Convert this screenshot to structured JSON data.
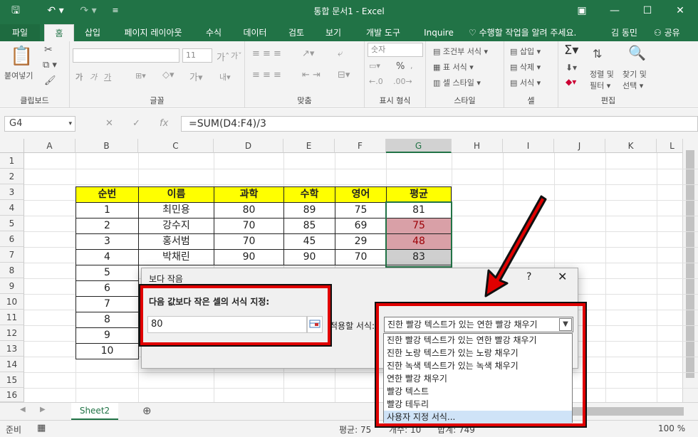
{
  "titlebar": {
    "title": "통합 문서1 - Excel",
    "save_icon": "save-icon",
    "undo_icon": "undo-icon",
    "redo_icon": "redo-icon"
  },
  "tabs": [
    "파일",
    "홈",
    "삽입",
    "페이지 레이아웃",
    "수식",
    "데이터",
    "검토",
    "보기",
    "개발 도구",
    "Inquire"
  ],
  "tellme": "수행할 작업을 알려 주세요.",
  "user": "김 동민",
  "share": "공유",
  "ribbon": {
    "clipboard": {
      "label": "클립보드",
      "paste": "붙여넣기"
    },
    "font": {
      "label": "글꼴",
      "size": "11",
      "bold": "가",
      "italic": "가",
      "underline": "가"
    },
    "alignment": {
      "label": "맞춤"
    },
    "number": {
      "label": "표시 형식",
      "format": "숫자",
      "percent": "%"
    },
    "styles": {
      "label": "스타일",
      "conditional": "조건부 서식",
      "table": "표 서식",
      "cell": "셀 스타일"
    },
    "cells": {
      "label": "셀",
      "insert": "삽입",
      "delete": "삭제",
      "format": "서식"
    },
    "editing": {
      "label": "편집",
      "sort": "정렬 및",
      "filter": "필터",
      "find": "찾기 및",
      "select": "선택"
    }
  },
  "formula_bar": {
    "namebox": "G4",
    "formula": "=SUM(D4:F4)/3",
    "fx": "fx"
  },
  "columns": [
    "A",
    "B",
    "C",
    "D",
    "E",
    "F",
    "G",
    "H",
    "I",
    "J",
    "K",
    "L"
  ],
  "rows": [
    "1",
    "2",
    "3",
    "4",
    "5",
    "6",
    "7",
    "8",
    "9",
    "10",
    "11",
    "12",
    "13",
    "14",
    "15",
    "16"
  ],
  "table": {
    "headers": [
      "순번",
      "이름",
      "과학",
      "수학",
      "영어",
      "평균"
    ],
    "data": [
      [
        "1",
        "최민용",
        "80",
        "89",
        "75",
        "81"
      ],
      [
        "2",
        "강수지",
        "70",
        "85",
        "69",
        "75"
      ],
      [
        "3",
        "홍서범",
        "70",
        "45",
        "29",
        "48"
      ],
      [
        "4",
        "박채린",
        "90",
        "90",
        "70",
        "83"
      ],
      [
        "5"
      ],
      [
        "6"
      ],
      [
        "7"
      ],
      [
        "8"
      ],
      [
        "9"
      ],
      [
        "10"
      ]
    ]
  },
  "sheet": {
    "name": "Sheet2"
  },
  "status": {
    "mode": "준비",
    "avg": "평균: 75",
    "count": "개수: 10",
    "sum": "합계: 749",
    "zoom": "100 %"
  },
  "dialog": {
    "title": "보다 작음",
    "prompt": "다음 값보다 작은 셀의 서식 지정:",
    "value": "80",
    "with_label": "적용할 서식:",
    "selected": "진한 빨강 텍스트가 있는 연한 빨강 채우기",
    "options": [
      "진한 빨강 텍스트가 있는 연한 빨강 채우기",
      "진한 노랑 텍스트가 있는 노랑 채우기",
      "진한 녹색 텍스트가 있는 녹색 채우기",
      "연한 빨강 채우기",
      "빨강 텍스트",
      "빨강 테두리",
      "사용자 지정 서식..."
    ]
  },
  "colors": {
    "accent": "#217346",
    "highlight_red": "#e00000",
    "yellow": "#ffff00"
  }
}
